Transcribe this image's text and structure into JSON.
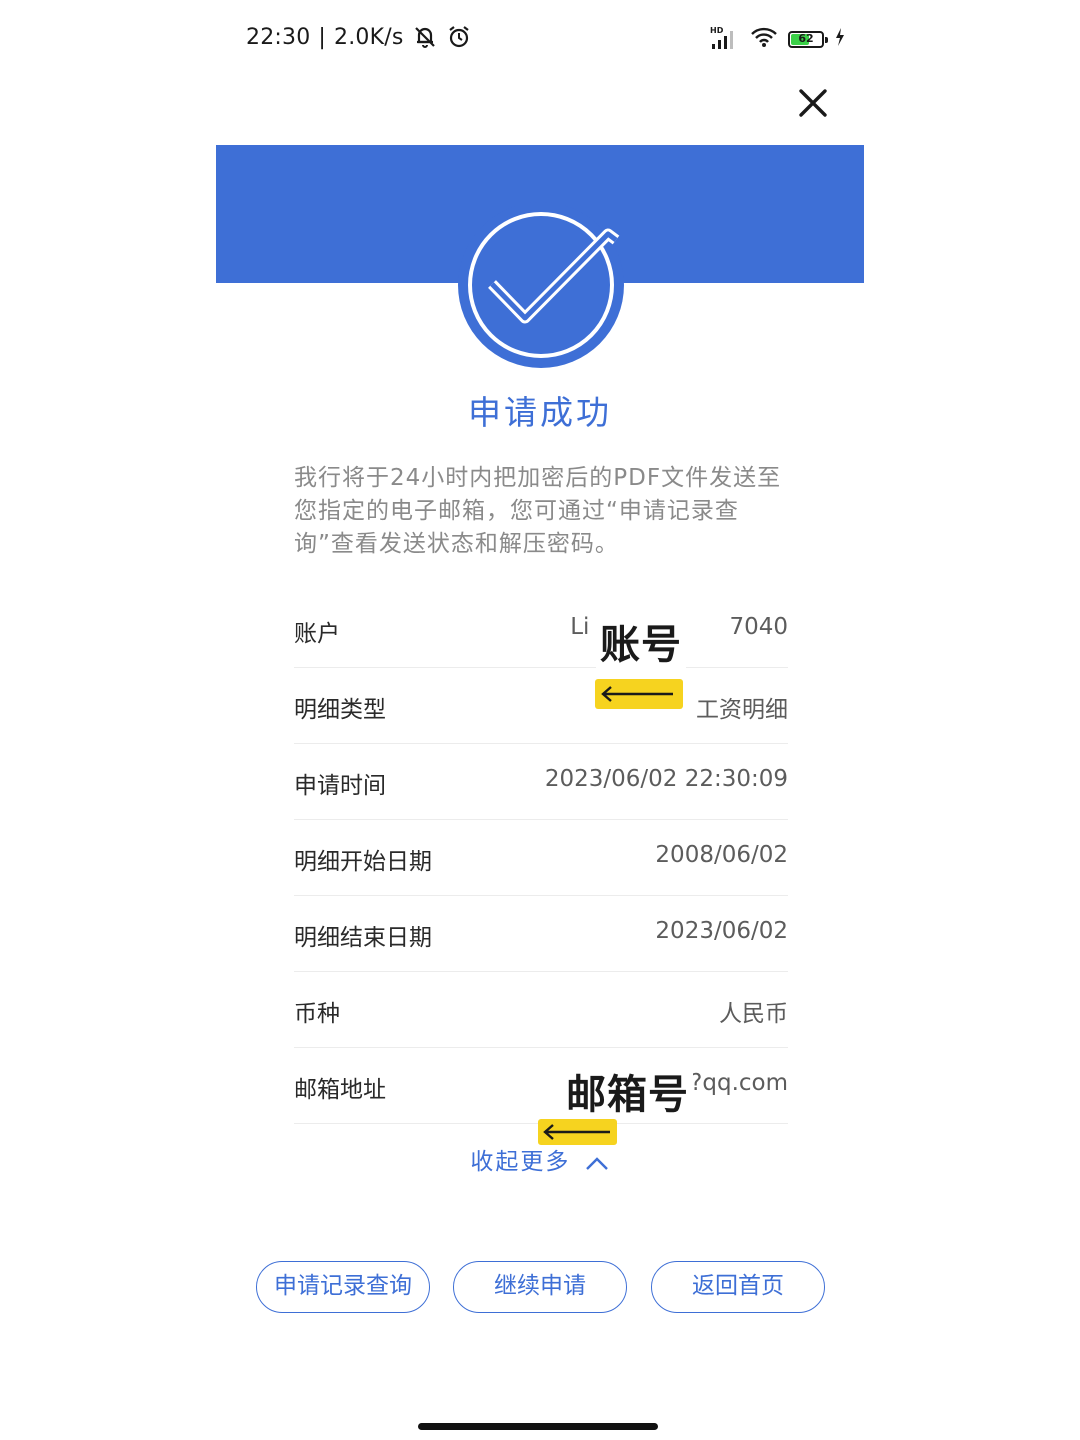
{
  "status_bar": {
    "time": "22:30",
    "speed": "2.0K/s",
    "battery_level": "62",
    "battery_fraction": 0.62,
    "hd_label": "HD",
    "icons": [
      "mute-bell-icon",
      "alarm-icon",
      "signal-icon",
      "wifi-icon",
      "battery-icon",
      "charging-icon"
    ]
  },
  "header": {
    "close_icon": "close-icon"
  },
  "result": {
    "icon": "check-circle-icon",
    "title": "申请成功",
    "description": "我行将于24小时内把加密后的PDF文件发送至您指定的电子邮箱，您可通过“申请记录查询”查看发送状态和解压密码。"
  },
  "details": {
    "rows": [
      {
        "label": "账户",
        "value_left": "Li",
        "value_right": "7040"
      },
      {
        "label": "明细类型",
        "value": "工资明细"
      },
      {
        "label": "申请时间",
        "value": "2023/06/02 22:30:09"
      },
      {
        "label": "明细开始日期",
        "value": "2008/06/02"
      },
      {
        "label": "明细结束日期",
        "value": "2023/06/02"
      },
      {
        "label": "币种",
        "value": "人民币"
      },
      {
        "label": "邮箱地址",
        "value": "?qq.com"
      }
    ]
  },
  "annotations": {
    "account_note": "账号",
    "email_note": "邮箱号",
    "accent_color": "#f6d31f"
  },
  "collapse": {
    "label": "收起更多",
    "icon": "chevron-up-icon"
  },
  "actions": {
    "query_label": "申请记录查询",
    "continue_label": "继续申请",
    "home_label": "返回首页"
  },
  "colors": {
    "brand": "#3e6fd6",
    "text": "#2a2a2a",
    "muted": "#8a8a8a"
  }
}
